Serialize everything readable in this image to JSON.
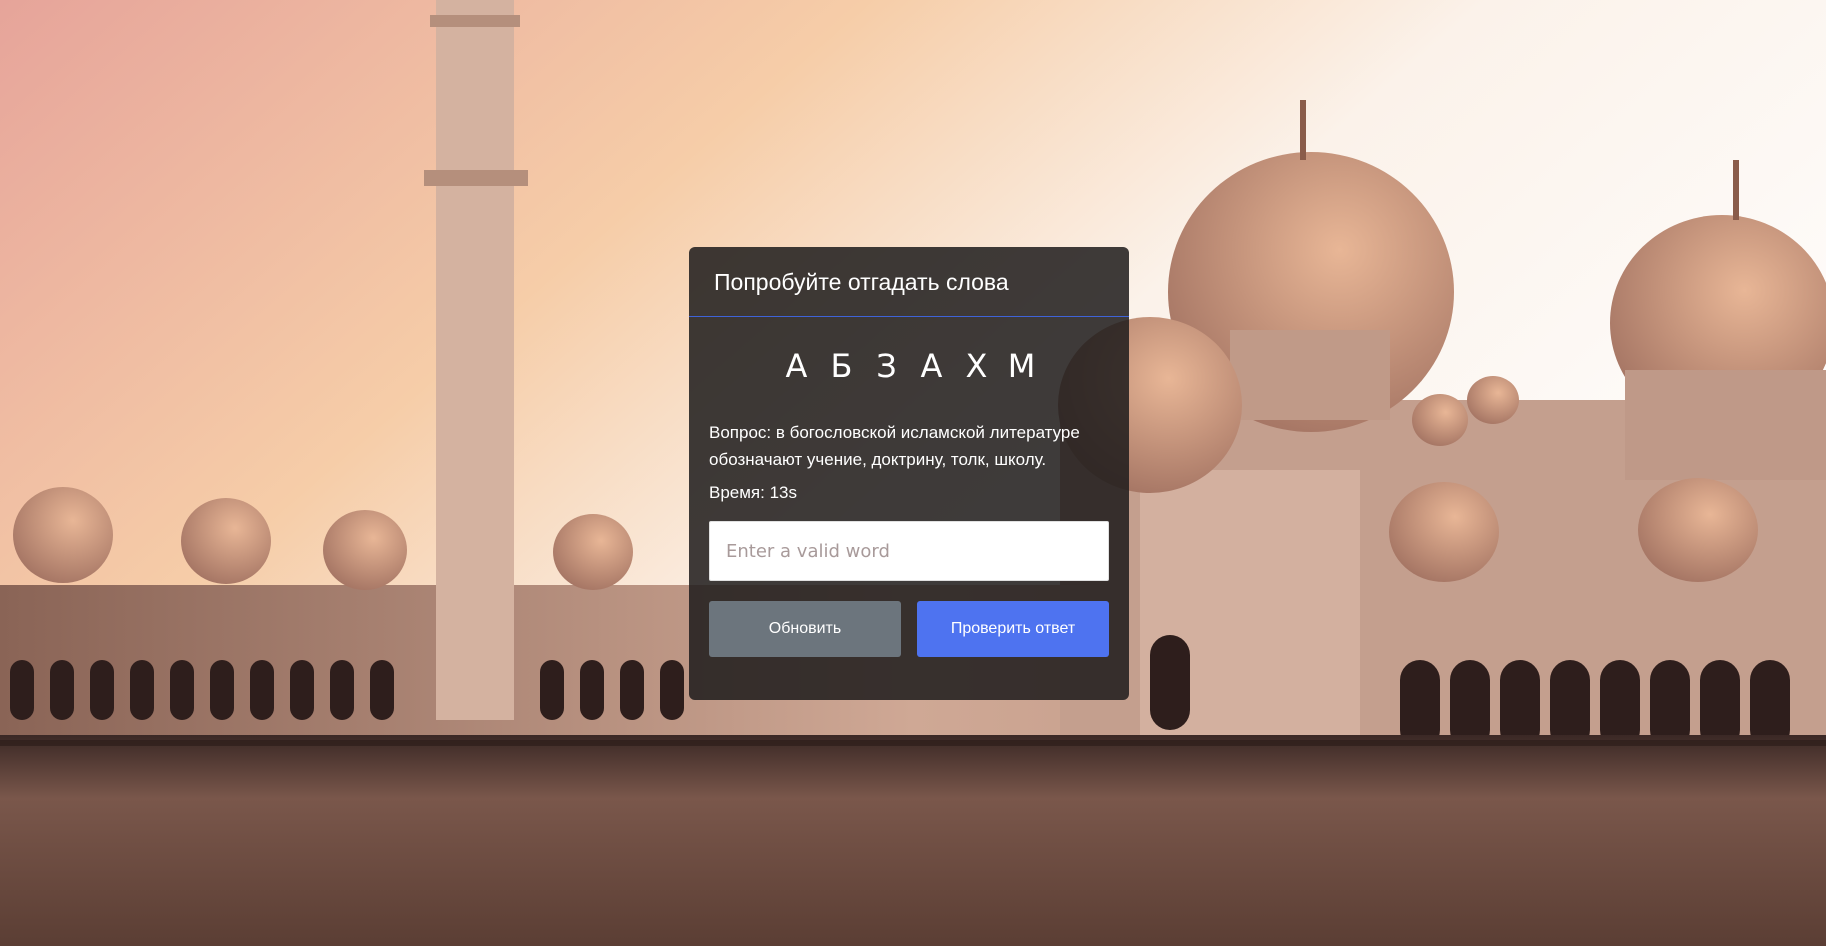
{
  "background": {
    "subject": "mosque-at-sunset-photo",
    "sky_color": "#f4cdb0",
    "stone_color": "#c9a492",
    "floor_color": "#5e4138"
  },
  "game": {
    "title": "Попробуйте отгадать слова",
    "letters": [
      "А",
      "Б",
      "З",
      "А",
      "Х",
      "М"
    ],
    "question": "Вопрос: в богословской исламской литературе обозначают учение, доктрину, толк, школу.",
    "timer": "Время: 13s",
    "input": {
      "value": "",
      "placeholder": "Enter a valid word"
    },
    "refresh_label": "Обновить",
    "check_label": "Проверить ответ",
    "colors": {
      "card_bg": "#1e1c1c",
      "header_divider": "#3f63d8",
      "refresh_button": "#6c757d",
      "check_button": "#4e73f0"
    }
  }
}
